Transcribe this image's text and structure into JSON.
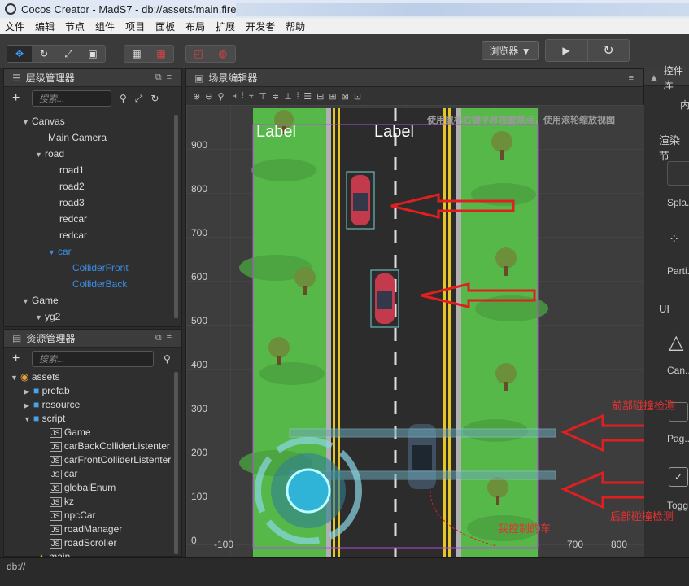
{
  "window": {
    "title": "Cocos Creator - MadS7 - db://assets/main.fire"
  },
  "menu": [
    "文件",
    "编辑",
    "节点",
    "组件",
    "项目",
    "面板",
    "布局",
    "扩展",
    "开发者",
    "帮助"
  ],
  "toolbar": {
    "browser_label": "浏览器 ▼",
    "play_icon": "▶",
    "refresh_icon": "↻"
  },
  "hierarchy": {
    "title": "层级管理器",
    "search_placeholder": "搜索...",
    "items": [
      {
        "label": "Canvas",
        "expanded": true
      },
      {
        "label": "Main Camera"
      },
      {
        "label": "road",
        "expanded": true
      },
      {
        "label": "road1"
      },
      {
        "label": "road2"
      },
      {
        "label": "road3"
      },
      {
        "label": "redcar"
      },
      {
        "label": "redcar"
      },
      {
        "label": "car",
        "expanded": true
      },
      {
        "label": "ColliderFront"
      },
      {
        "label": "ColliderBack"
      },
      {
        "label": "Game",
        "expanded": true
      },
      {
        "label": "yg2",
        "expanded": true
      }
    ]
  },
  "assets": {
    "title": "资源管理器",
    "search_placeholder": "搜索...",
    "items": [
      {
        "label": "assets"
      },
      {
        "label": "prefab"
      },
      {
        "label": "resource"
      },
      {
        "label": "script"
      },
      {
        "label": "Game"
      },
      {
        "label": "carBackColliderListenter"
      },
      {
        "label": "carFrontColliderListenter"
      },
      {
        "label": "car"
      },
      {
        "label": "globalEnum"
      },
      {
        "label": "kz"
      },
      {
        "label": "npcCar"
      },
      {
        "label": "roadManager"
      },
      {
        "label": "roadScroller"
      },
      {
        "label": "main"
      }
    ],
    "js_badge": "JS"
  },
  "scene": {
    "title": "场景编辑器",
    "hint": "使用鼠标右键平移视窗焦点，使用滚轮缩放视图",
    "labels": [
      "Label",
      "Label"
    ],
    "y_axis": [
      "900",
      "800",
      "700",
      "600",
      "500",
      "400",
      "300",
      "200",
      "100",
      "0"
    ],
    "x_axis": [
      "-100",
      "700",
      "800"
    ]
  },
  "inspector": {
    "title": "控件库",
    "tab": "内",
    "section1": "渲染节",
    "items": [
      "Spla...",
      "Parti...",
      "UI",
      "Can...",
      "Pag...",
      "Togg..."
    ]
  },
  "annotations": {
    "front": "前部碰撞检测",
    "back": "后部碰撞检测",
    "my_car": "我控制的车"
  },
  "status": {
    "path": "db://"
  },
  "colors": {
    "accent": "#3c9cff",
    "annotation": "#e83232",
    "grass": "#57b84a",
    "road": "#2c2c2c"
  }
}
